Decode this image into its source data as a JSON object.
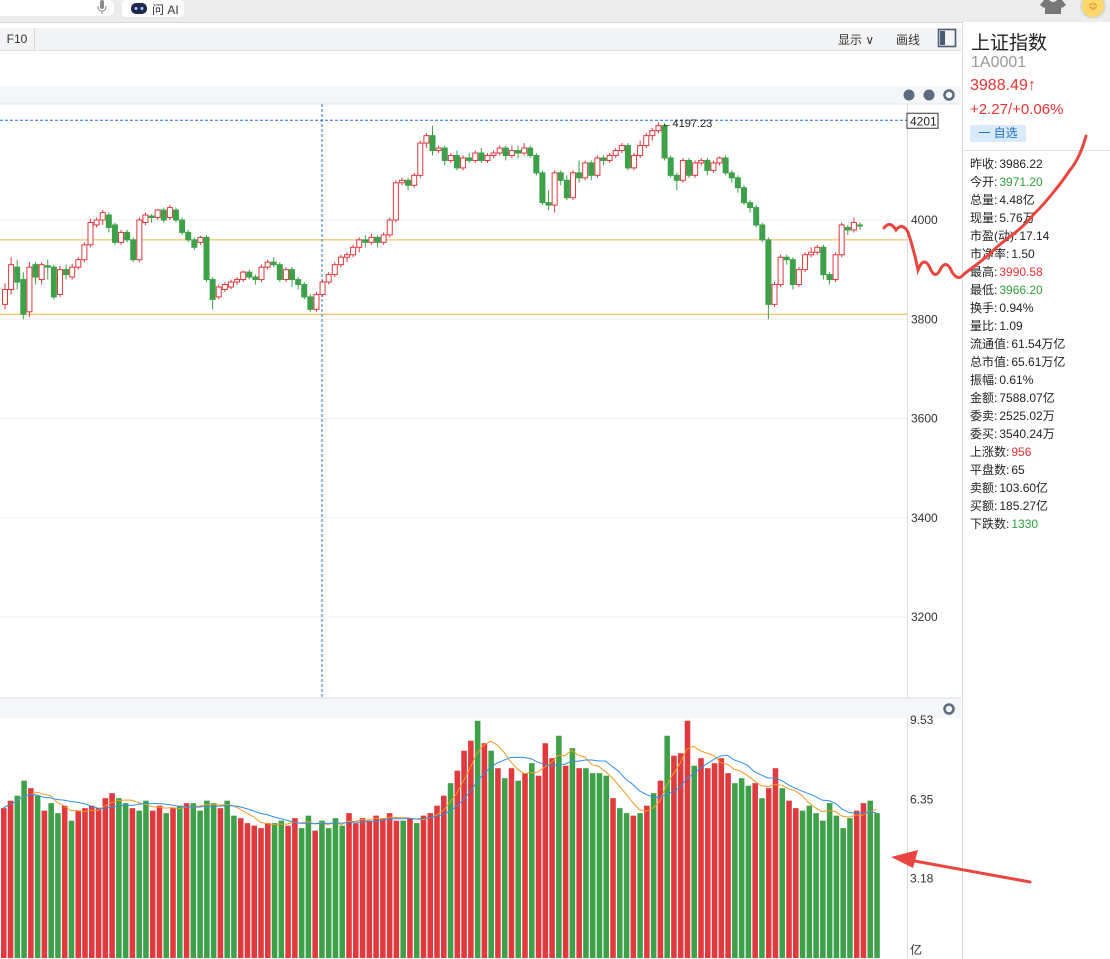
{
  "toolbar": {
    "f10_label": "F10",
    "show_label": "显示 ∨",
    "draw_label": "画线",
    "ai_label": "问 AI"
  },
  "quote": {
    "name": "上证指数",
    "code": "1A0001",
    "price": "3988.49↑",
    "change": "+2.27/+0.06%",
    "watch_label": "一 自选",
    "stats": [
      {
        "label": "昨收:",
        "value": "3986.22",
        "color": "normal"
      },
      {
        "label": "今开:",
        "value": "3971.20",
        "color": "green"
      },
      {
        "label": "总量:",
        "value": "4.48亿",
        "color": "normal"
      },
      {
        "label": "现量:",
        "value": "5.76万",
        "color": "normal"
      },
      {
        "label": "市盈(动):",
        "value": "17.14",
        "color": "normal"
      },
      {
        "label": "市净率:",
        "value": "1.50",
        "color": "normal"
      },
      {
        "label": "最高:",
        "value": "3990.58",
        "color": "red"
      },
      {
        "label": "最低:",
        "value": "3966.20",
        "color": "green"
      },
      {
        "label": "换手:",
        "value": "0.94%",
        "color": "normal"
      },
      {
        "label": "量比:",
        "value": "1.09",
        "color": "normal"
      },
      {
        "label": "流通值:",
        "value": "61.54万亿",
        "color": "normal"
      },
      {
        "label": "总市值:",
        "value": "65.61万亿",
        "color": "normal"
      },
      {
        "label": "振幅:",
        "value": "0.61%",
        "color": "normal"
      },
      {
        "label": "金额:",
        "value": "7588.07亿",
        "color": "normal"
      },
      {
        "label": "委卖:",
        "value": "2525.02万",
        "color": "normal"
      },
      {
        "label": "委买:",
        "value": "3540.24万",
        "color": "normal"
      },
      {
        "label": "上涨数:",
        "value": "956",
        "color": "red"
      },
      {
        "label": "平盘数:",
        "value": "65",
        "color": "normal"
      },
      {
        "label": "卖额:",
        "value": "103.60亿",
        "color": "normal"
      },
      {
        "label": "买额:",
        "value": "185.27亿",
        "color": "normal"
      },
      {
        "label": "下跌数:",
        "value": "1330",
        "color": "green"
      }
    ]
  },
  "colors": {
    "up": "#e0393e",
    "down": "#3ea14a",
    "ma5": "#f39a1e",
    "ma10": "#2f8fe8",
    "hline": "#f2b54b",
    "crosshair": "#1f6fd1"
  },
  "chart_data": [
    {
      "type": "candlestick",
      "price_axis_ticks": [
        "4000",
        "3800",
        "3600",
        "3400",
        "3200"
      ],
      "max_label": "←4197.23",
      "crosshair_value": "4201",
      "horizontal_lines": [
        3960,
        3810
      ],
      "candles": [
        [
          3830,
          3860,
          3820,
          3872
        ],
        [
          3860,
          3910,
          3850,
          3925
        ],
        [
          3905,
          3875,
          3860,
          3920
        ],
        [
          3880,
          3810,
          3800,
          3895
        ],
        [
          3815,
          3905,
          3805,
          3915
        ],
        [
          3910,
          3885,
          3870,
          3915
        ],
        [
          3880,
          3910,
          3870,
          3915
        ],
        [
          3908,
          3905,
          3880,
          3920
        ],
        [
          3905,
          3845,
          3840,
          3910
        ],
        [
          3850,
          3900,
          3845,
          3908
        ],
        [
          3900,
          3890,
          3880,
          3910
        ],
        [
          3885,
          3905,
          3880,
          3912
        ],
        [
          3905,
          3920,
          3900,
          3925
        ],
        [
          3920,
          3950,
          3915,
          3955
        ],
        [
          3950,
          3995,
          3945,
          4002
        ],
        [
          3990,
          4000,
          3985,
          4005
        ],
        [
          4000,
          4015,
          3990,
          4020
        ],
        [
          4010,
          3985,
          3975,
          4015
        ],
        [
          3990,
          3955,
          3950,
          3995
        ],
        [
          3955,
          3975,
          3950,
          3980
        ],
        [
          3975,
          3960,
          3955,
          3980
        ],
        [
          3960,
          3920,
          3915,
          3965
        ],
        [
          3920,
          4000,
          3915,
          4005
        ],
        [
          3995,
          4010,
          3990,
          4015
        ],
        [
          4008,
          4005,
          3995,
          4012
        ],
        [
          4005,
          4020,
          4000,
          4022
        ],
        [
          4020,
          4000,
          3995,
          4025
        ],
        [
          4005,
          4025,
          4000,
          4030
        ],
        [
          4020,
          4000,
          3995,
          4025
        ],
        [
          4000,
          3975,
          3970,
          4005
        ],
        [
          3975,
          3960,
          3955,
          3980
        ],
        [
          3960,
          3945,
          3940,
          3965
        ],
        [
          3955,
          3965,
          3950,
          3968
        ],
        [
          3965,
          3880,
          3875,
          3970
        ],
        [
          3880,
          3840,
          3820,
          3885
        ],
        [
          3845,
          3865,
          3840,
          3870
        ],
        [
          3860,
          3870,
          3855,
          3875
        ],
        [
          3865,
          3875,
          3860,
          3880
        ],
        [
          3875,
          3880,
          3870,
          3885
        ],
        [
          3880,
          3895,
          3875,
          3898
        ],
        [
          3895,
          3885,
          3880,
          3900
        ],
        [
          3885,
          3880,
          3870,
          3890
        ],
        [
          3880,
          3905,
          3875,
          3910
        ],
        [
          3905,
          3915,
          3900,
          3920
        ],
        [
          3915,
          3910,
          3905,
          3925
        ],
        [
          3910,
          3880,
          3875,
          3915
        ],
        [
          3880,
          3900,
          3875,
          3905
        ],
        [
          3900,
          3880,
          3865,
          3905
        ],
        [
          3880,
          3870,
          3860,
          3885
        ],
        [
          3870,
          3845,
          3840,
          3875
        ],
        [
          3845,
          3820,
          3815,
          3850
        ],
        [
          3820,
          3850,
          3815,
          3855
        ],
        [
          3850,
          3875,
          3845,
          3880
        ],
        [
          3875,
          3890,
          3870,
          3895
        ],
        [
          3890,
          3910,
          3885,
          3915
        ],
        [
          3910,
          3925,
          3905,
          3930
        ],
        [
          3925,
          3930,
          3915,
          3935
        ],
        [
          3930,
          3945,
          3925,
          3950
        ],
        [
          3945,
          3960,
          3935,
          3965
        ],
        [
          3960,
          3955,
          3945,
          3970
        ],
        [
          3955,
          3965,
          3950,
          3972
        ],
        [
          3965,
          3955,
          3945,
          3970
        ],
        [
          3955,
          3970,
          3950,
          3975
        ],
        [
          3970,
          4000,
          3965,
          4005
        ],
        [
          4000,
          4075,
          3995,
          4080
        ],
        [
          4075,
          4080,
          4070,
          4085
        ],
        [
          4080,
          4070,
          4060,
          4085
        ],
        [
          4070,
          4090,
          4065,
          4095
        ],
        [
          4090,
          4155,
          4085,
          4160
        ],
        [
          4155,
          4170,
          4145,
          4175
        ],
        [
          4170,
          4140,
          4130,
          4190
        ],
        [
          4140,
          4145,
          4135,
          4150
        ],
        [
          4145,
          4120,
          4110,
          4150
        ],
        [
          4120,
          4130,
          4115,
          4135
        ],
        [
          4130,
          4105,
          4100,
          4140
        ],
        [
          4105,
          4125,
          4100,
          4130
        ],
        [
          4125,
          4120,
          4115,
          4135
        ],
        [
          4120,
          4135,
          4115,
          4140
        ],
        [
          4135,
          4120,
          4115,
          4145
        ],
        [
          4120,
          4130,
          4115,
          4135
        ],
        [
          4130,
          4135,
          4125,
          4140
        ],
        [
          4135,
          4145,
          4130,
          4150
        ],
        [
          4145,
          4130,
          4120,
          4150
        ],
        [
          4130,
          4140,
          4125,
          4150
        ],
        [
          4140,
          4135,
          4125,
          4150
        ],
        [
          4135,
          4145,
          4130,
          4155
        ],
        [
          4145,
          4130,
          4125,
          4150
        ],
        [
          4130,
          4095,
          4090,
          4135
        ],
        [
          4095,
          4035,
          4030,
          4100
        ],
        [
          4035,
          4030,
          4020,
          4060
        ],
        [
          4030,
          4095,
          4015,
          4100
        ],
        [
          4095,
          4080,
          4070,
          4100
        ],
        [
          4080,
          4045,
          4040,
          4090
        ],
        [
          4045,
          4095,
          4040,
          4100
        ],
        [
          4095,
          4085,
          4075,
          4120
        ],
        [
          4085,
          4115,
          4080,
          4120
        ],
        [
          4115,
          4090,
          4080,
          4120
        ],
        [
          4090,
          4125,
          4085,
          4130
        ],
        [
          4125,
          4120,
          4110,
          4130
        ],
        [
          4120,
          4130,
          4115,
          4135
        ],
        [
          4130,
          4140,
          4125,
          4145
        ],
        [
          4140,
          4150,
          4135,
          4155
        ],
        [
          4150,
          4105,
          4100,
          4155
        ],
        [
          4105,
          4130,
          4100,
          4135
        ],
        [
          4130,
          4150,
          4125,
          4160
        ],
        [
          4150,
          4170,
          4145,
          4175
        ],
        [
          4170,
          4180,
          4160,
          4185
        ],
        [
          4180,
          4190,
          4175,
          4197
        ],
        [
          4190,
          4125,
          4120,
          4195
        ],
        [
          4125,
          4090,
          4085,
          4130
        ],
        [
          4090,
          4080,
          4060,
          4095
        ],
        [
          4080,
          4120,
          4075,
          4125
        ],
        [
          4120,
          4090,
          4085,
          4125
        ],
        [
          4090,
          4115,
          4085,
          4120
        ],
        [
          4115,
          4120,
          4110,
          4125
        ],
        [
          4120,
          4100,
          4090,
          4125
        ],
        [
          4100,
          4115,
          4095,
          4120
        ],
        [
          4115,
          4125,
          4110,
          4128
        ],
        [
          4125,
          4095,
          4090,
          4130
        ],
        [
          4095,
          4085,
          4075,
          4100
        ],
        [
          4085,
          4065,
          4055,
          4090
        ],
        [
          4065,
          4035,
          4030,
          4070
        ],
        [
          4035,
          4025,
          4015,
          4040
        ],
        [
          4025,
          3990,
          3985,
          4030
        ],
        [
          3990,
          3960,
          3955,
          3995
        ],
        [
          3960,
          3830,
          3800,
          3965
        ],
        [
          3830,
          3870,
          3825,
          3875
        ],
        [
          3870,
          3925,
          3865,
          3930
        ],
        [
          3925,
          3920,
          3910,
          3930
        ],
        [
          3920,
          3870,
          3860,
          3925
        ],
        [
          3870,
          3900,
          3865,
          3905
        ],
        [
          3900,
          3930,
          3895,
          3935
        ],
        [
          3930,
          3935,
          3925,
          3945
        ],
        [
          3935,
          3945,
          3930,
          3950
        ],
        [
          3945,
          3890,
          3880,
          3950
        ],
        [
          3890,
          3880,
          3870,
          3895
        ],
        [
          3880,
          3930,
          3875,
          3935
        ],
        [
          3930,
          3990,
          3925,
          3995
        ],
        [
          3985,
          3980,
          3970,
          3990
        ],
        [
          3980,
          3995,
          3975,
          4005
        ],
        [
          3990,
          3988,
          3980,
          3995
        ]
      ]
    },
    {
      "type": "bar",
      "volume_axis_ticks": [
        "9.53",
        "6.35",
        "3.18",
        "亿"
      ],
      "volumes_up": [
        5.9,
        6.0,
        6.9,
        6.4,
        6.8
      ],
      "volume_values": [
        6.0,
        6.3,
        6.5,
        7.1,
        6.8,
        6.5,
        5.9,
        6.2,
        5.8,
        6.1,
        5.5,
        5.9,
        6.0,
        6.1,
        6.0,
        6.4,
        6.6,
        6.4,
        6.2,
        6.0,
        5.9,
        6.3,
        5.9,
        6.1,
        5.8,
        6.0,
        6.1,
        6.2,
        6.2,
        5.9,
        6.3,
        6.2,
        6.0,
        6.3,
        5.7,
        5.6,
        5.4,
        5.3,
        5.2,
        5.4,
        5.4,
        5.5,
        5.3,
        5.6,
        5.2,
        5.7,
        5.1,
        5.5,
        5.2,
        5.6,
        5.3,
        5.8,
        5.4,
        5.6,
        5.5,
        5.7,
        5.6,
        5.8,
        5.5,
        5.5,
        5.6,
        5.4,
        5.7,
        5.8,
        6.1,
        6.5,
        7.0,
        7.5,
        8.3,
        8.7,
        9.5,
        8.6,
        8.3,
        7.6,
        7.2,
        7.6,
        7.1,
        7.4,
        7.8,
        7.3,
        8.6,
        8.0,
        8.9,
        7.7,
        8.4,
        7.6,
        7.6,
        7.4,
        7.4,
        7.3,
        6.4,
        6.0,
        5.8,
        5.7,
        5.8,
        6.1,
        6.6,
        7.1,
        8.9,
        8.1,
        8.2,
        9.5,
        7.7,
        8.0,
        7.6,
        7.8,
        8.0,
        7.4,
        7.0,
        7.2,
        6.9,
        7.0,
        6.4,
        6.8,
        7.6,
        6.8,
        6.3,
        6.0,
        5.9,
        6.1,
        5.8,
        5.5,
        6.2,
        5.7,
        5.2,
        5.6,
        5.9,
        6.2,
        6.3,
        5.8
      ]
    }
  ]
}
